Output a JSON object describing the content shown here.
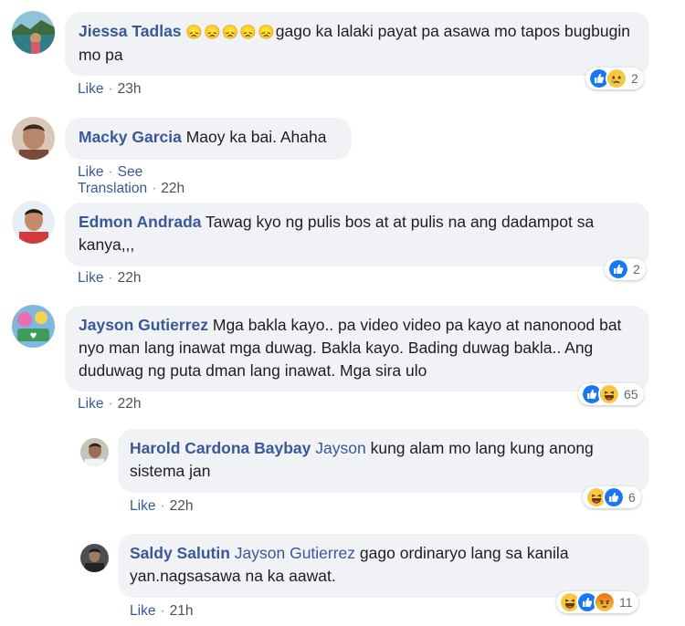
{
  "comments": [
    {
      "author": "Jiessa Tadlas",
      "emojis": "😞😞😞😞😞",
      "text": "gago ka lalaki payat pa asawa mo tapos bugbugin mo pa",
      "like": "Like",
      "time": "23h",
      "reaction_count": "2",
      "reactions": [
        "like-reaction",
        "sad-reaction"
      ]
    },
    {
      "author": "Macky Garcia",
      "text": "Maoy ka bai. Ahaha",
      "like": "Like",
      "translate": "See Translation",
      "time": "22h"
    },
    {
      "author": "Edmon Andrada",
      "text": "Tawag kyo ng pulis bos at at pulis na ang dadampot sa kanya,,,",
      "like": "Like",
      "time": "22h",
      "reaction_count": "2",
      "reactions": [
        "like-reaction"
      ]
    },
    {
      "author": "Jayson Gutierrez",
      "text": "Mga bakla kayo.. pa video video pa kayo at nanonood bat nyo man lang inawat mga duwag. Bakla kayo. Bading duwag bakla.. Ang duduwag ng puta dman lang inawat. Mga sira ulo",
      "like": "Like",
      "time": "22h",
      "reaction_count": "65",
      "reactions": [
        "like-reaction",
        "haha-reaction"
      ]
    }
  ],
  "replies": [
    {
      "author": "Harold Cardona Baybay",
      "mention": "Jayson",
      "text": "kung alam mo lang kung anong sistema jan",
      "like": "Like",
      "time": "22h",
      "reaction_count": "6",
      "reactions": [
        "haha-reaction",
        "like-reaction"
      ]
    },
    {
      "author": "Saldy Salutin",
      "mention": "Jayson Gutierrez",
      "text": "gago ordinaryo lang sa kanila yan.nagsasawa na ka aawat.",
      "like": "Like",
      "time": "21h",
      "reaction_count": "11",
      "reactions": [
        "haha-reaction",
        "like-reaction",
        "angry-reaction"
      ]
    }
  ],
  "colors": {
    "link": "#385898",
    "bubble": "#f0f2f5",
    "like_blue": "#1877f2",
    "emoji_yellow": "#f7c744",
    "angry_orange": "#e9710f"
  }
}
